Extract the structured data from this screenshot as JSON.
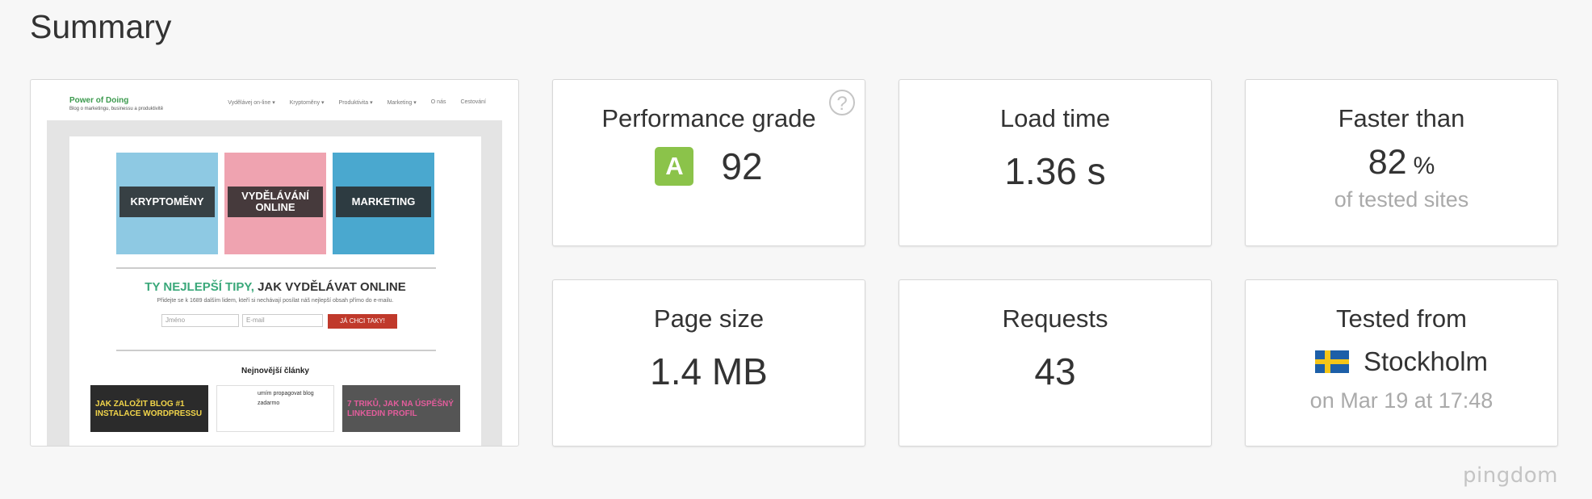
{
  "summary_title": "Summary",
  "thumbnail": {
    "logo": "Power of Doing",
    "tagline": "Blog o marketingu, businessu a produktivitě",
    "nav": [
      "Vydělávej on-line ▾",
      "Kryptoměny ▾",
      "Produktivita ▾",
      "Marketing ▾",
      "O nás",
      "Cestování"
    ],
    "tiles": [
      "KRYPTOMĚNY",
      "VYDĚLÁVÁNÍ ONLINE",
      "MARKETING"
    ],
    "headline_green": "TY NEJLEPŠÍ TIPY,",
    "headline_rest": " JAK VYDĚLÁVAT ONLINE",
    "description": "Přidejte se k 1689 dalším lidem, kteří si nechávají posílat náš nejlepší obsah přímo do e-mailu.",
    "name_placeholder": "Jméno",
    "email_placeholder": "E-mail",
    "cta": "JÁ CHCI TAKY!",
    "latest": "Nejnovější články",
    "articles": [
      "JAK ZALOŽIT BLOG #1 INSTALACE WORDPRESSU",
      "umím propagovat blog zadarmo",
      "7 TRIKŮ, JAK NA ÚSPĚŠNÝ LINKEDIN PROFIL"
    ]
  },
  "cards": {
    "grade": {
      "label": "Performance grade",
      "letter": "A",
      "value": "92",
      "help": "?"
    },
    "load": {
      "label": "Load time",
      "value": "1.36 s"
    },
    "faster": {
      "label": "Faster than",
      "value": "82",
      "unit": "%",
      "sub": "of tested sites"
    },
    "size": {
      "label": "Page size",
      "value": "1.4 MB"
    },
    "requests": {
      "label": "Requests",
      "value": "43"
    },
    "tested": {
      "label": "Tested from",
      "location": "Stockholm",
      "date": "on Mar 19 at 17:48"
    }
  },
  "watermark": "pingdom",
  "colors": {
    "grade_green": "#8bc34a",
    "accent_green": "#3aa87a",
    "cta_red": "#c0392b"
  }
}
